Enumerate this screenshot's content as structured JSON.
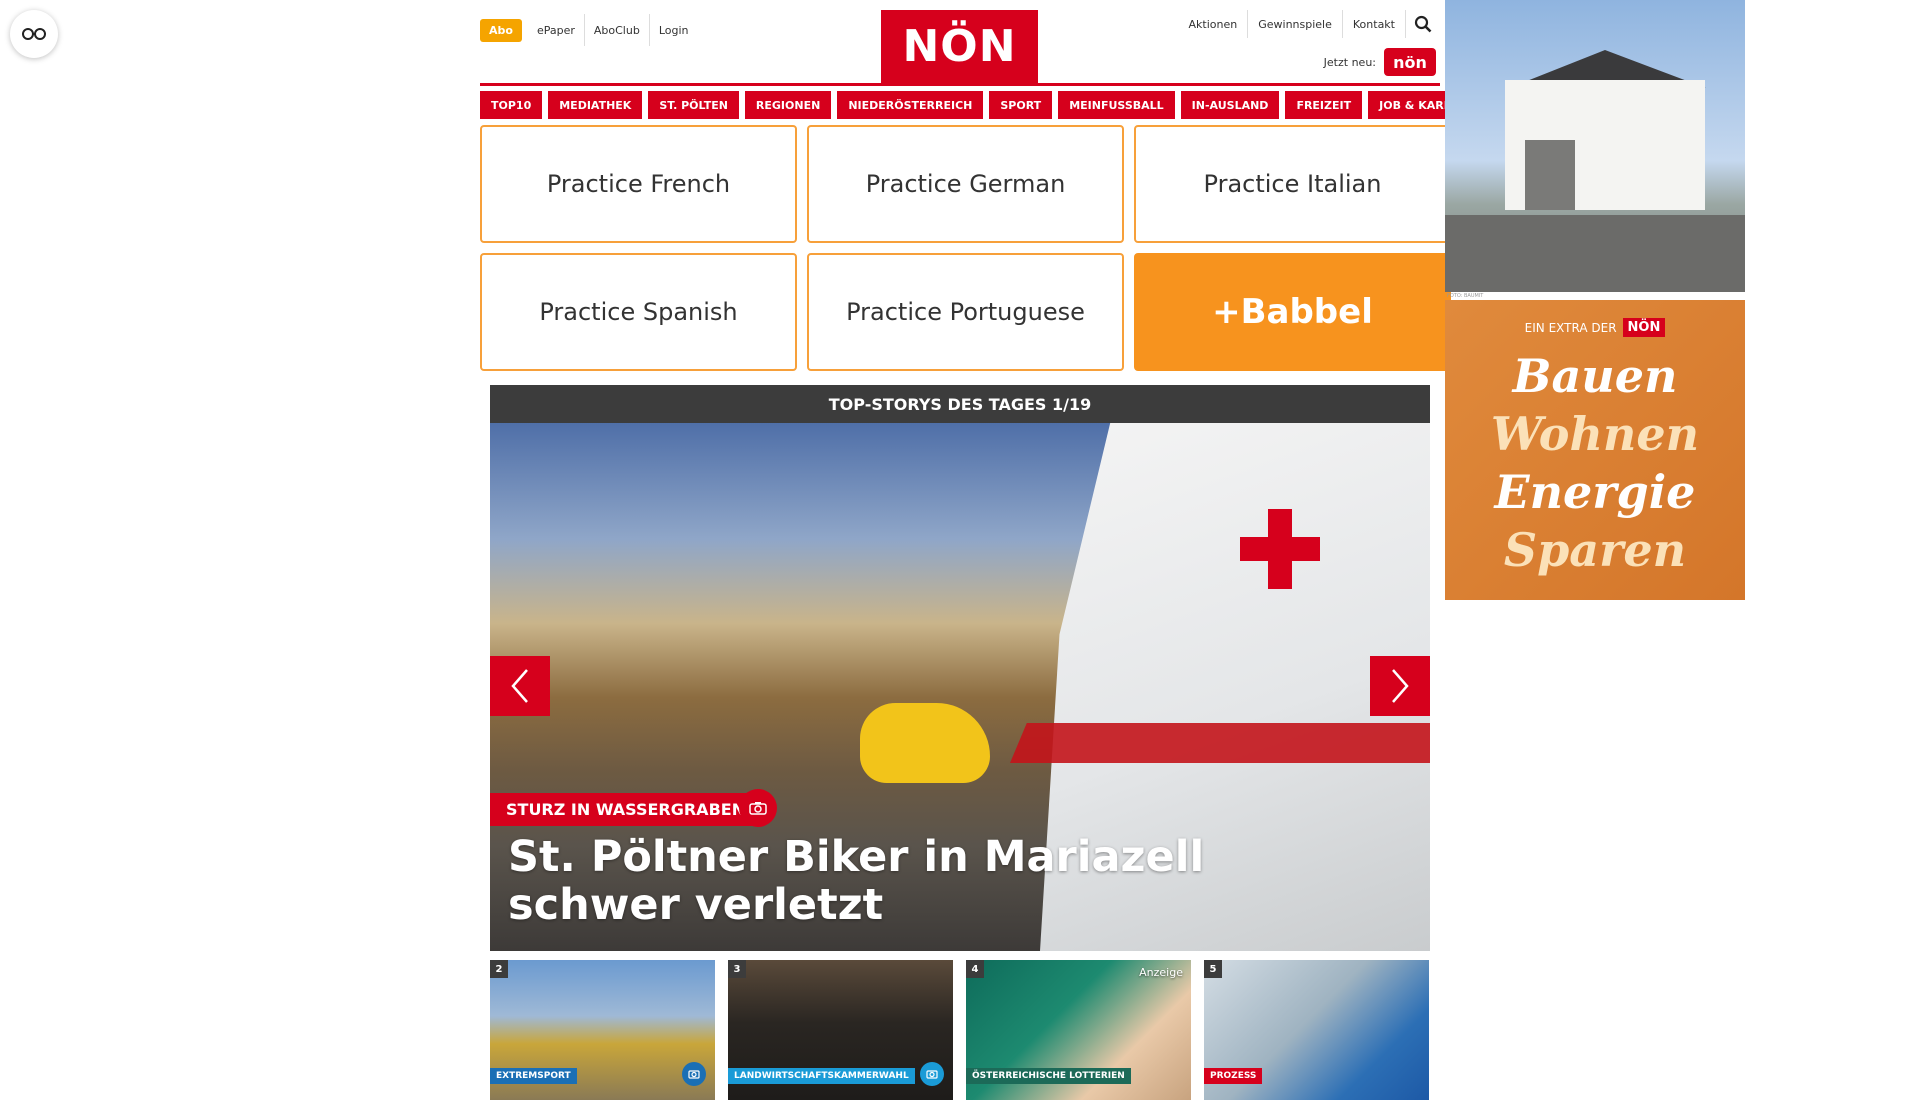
{
  "header": {
    "left_links": [
      "Abo",
      "ePaper",
      "AboClub",
      "Login"
    ],
    "logo": "NÖN",
    "right_links": [
      "Aktionen",
      "Gewinnspiele",
      "Kontakt"
    ],
    "jetzt_label": "Jetzt neu:",
    "jetzt_badge": "nön"
  },
  "nav": [
    "TOP10",
    "MEDIATHEK",
    "ST. PÖLTEN",
    "REGIONEN",
    "NIEDERÖSTERREICH",
    "SPORT",
    "MEINFUSSBALL",
    "IN-AUSLAND",
    "FREIZEIT",
    "JOB & KARRIERE"
  ],
  "ad_grid": {
    "cells": [
      "Practice French",
      "Practice German",
      "Practice Italian",
      "Practice Spanish",
      "Practice Portuguese"
    ],
    "brand": "+Babbel"
  },
  "stories": {
    "heading": "TOP-STORYS DES TAGES 1/19",
    "hero_tag": "STURZ IN WASSERGRABEN",
    "hero_title": "St. Pöltner Biker in Mariazell schwer verletzt",
    "thumbs": [
      {
        "num": "2",
        "tag": "EXTREMSPORT"
      },
      {
        "num": "3",
        "tag": "LANDWIRTSCHAFTSKAMMERWAHL"
      },
      {
        "num": "4",
        "tag": "ÖSTERREICHISCHE LOTTERIEN",
        "badge": "Anzeige"
      },
      {
        "num": "5",
        "tag": "PROZESS"
      }
    ]
  },
  "sidebar": {
    "house_credit": "FOTO: BAUMIT",
    "promo_head": "EIN EXTRA DER",
    "promo_brand": "NÖN",
    "promo_lines": [
      "Bauen",
      "Wohnen",
      "Energie",
      "Sparen"
    ]
  },
  "colors": {
    "brand_red": "#d6001c",
    "abo_yellow": "#f5a400",
    "babbel_orange": "#f7931e"
  }
}
